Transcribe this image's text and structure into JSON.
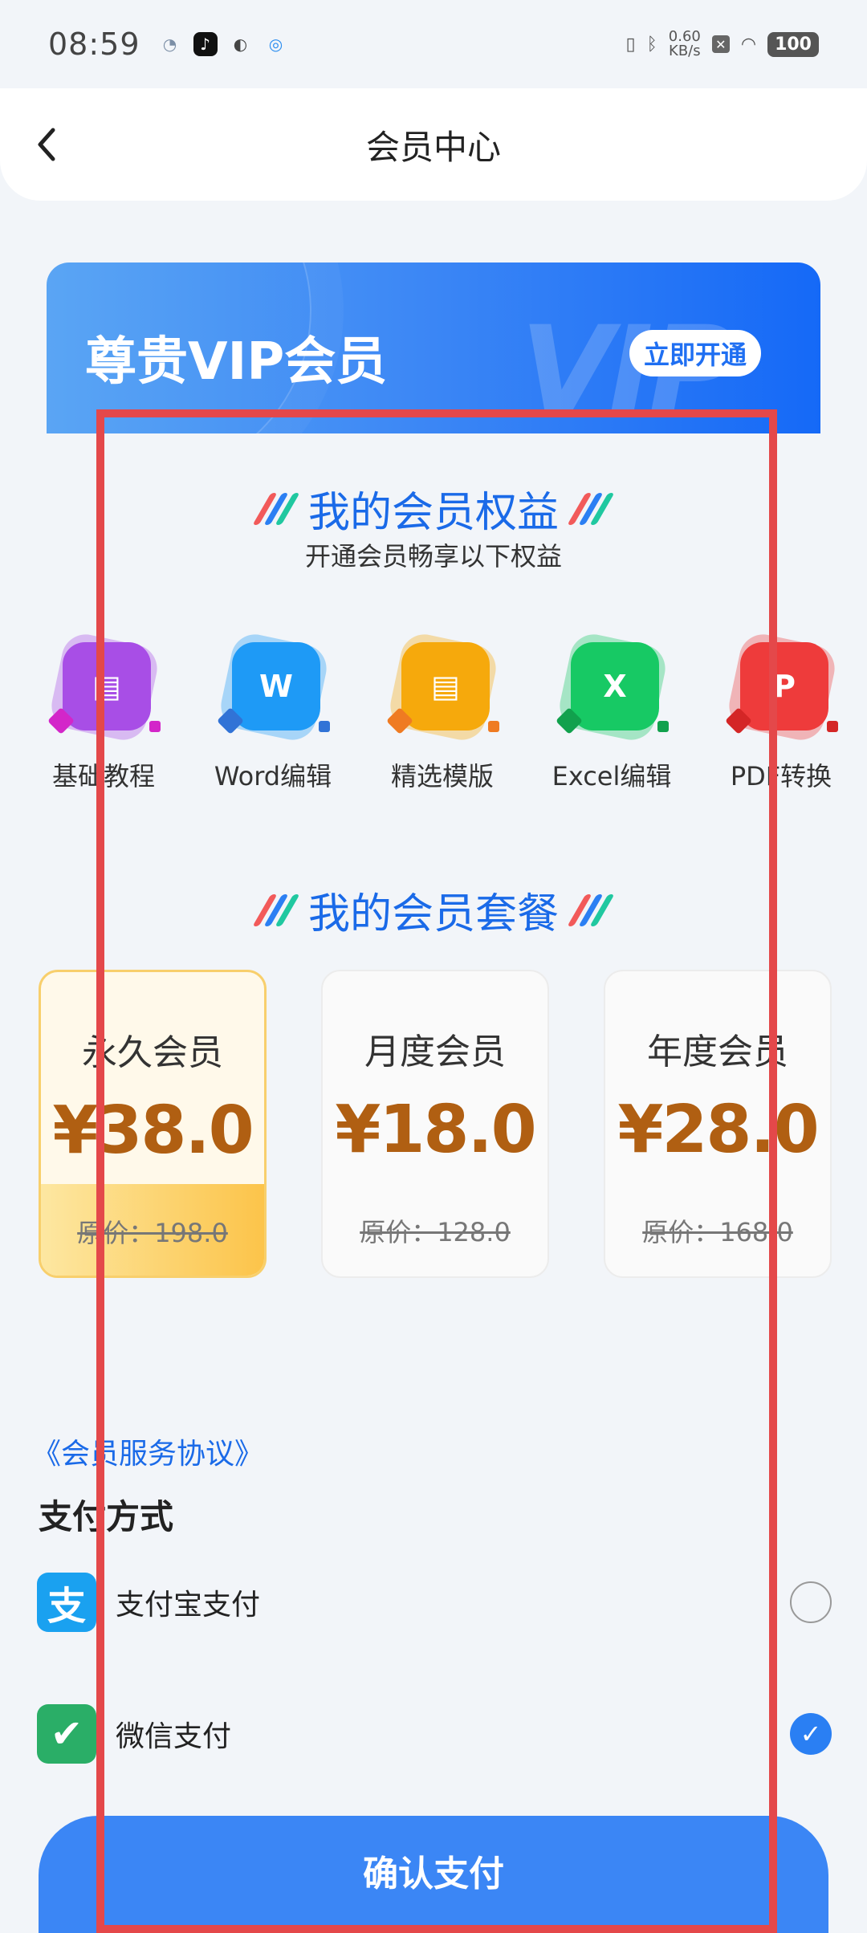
{
  "status_bar": {
    "time": "08:59",
    "net_speed_value": "0.60",
    "net_speed_unit": "KB/s",
    "battery": "100"
  },
  "header": {
    "title": "会员中心"
  },
  "banner": {
    "title": "尊贵VIP会员",
    "bg_text": "VIP",
    "open_button": "立即开通"
  },
  "benefits_section": {
    "title": "我的会员权益",
    "subtitle": "开通会员畅享以下权益",
    "items": [
      {
        "label": "基础教程",
        "icon": "tutorial-icon",
        "color": "#a84ee6",
        "glyph": "▤"
      },
      {
        "label": "Word编辑",
        "icon": "word-icon",
        "color": "#1e9af6",
        "glyph": "W"
      },
      {
        "label": "精选模版",
        "icon": "template-icon",
        "color": "#f6a90c",
        "glyph": "▤"
      },
      {
        "label": "Excel编辑",
        "icon": "excel-icon",
        "color": "#17c964",
        "glyph": "X"
      },
      {
        "label": "PDF转换",
        "icon": "pdf-icon",
        "color": "#ee3b3b",
        "glyph": "P"
      }
    ]
  },
  "plans_section": {
    "title": "我的会员套餐",
    "plans": [
      {
        "name": "永久会员",
        "price": "¥38.0",
        "original": "原价：198.0",
        "selected": true
      },
      {
        "name": "月度会员",
        "price": "¥18.0",
        "original": "原价：128.0",
        "selected": false
      },
      {
        "name": "年度会员",
        "price": "¥28.0",
        "original": "原价：168.0",
        "selected": false
      }
    ]
  },
  "agreement_link": "《会员服务协议》",
  "payment": {
    "title": "支付方式",
    "methods": [
      {
        "label": "支付宝支付",
        "icon": "alipay-icon",
        "color": "#1aa1f0",
        "selected": false
      },
      {
        "label": "微信支付",
        "icon": "wechat-icon",
        "color": "#2aae67",
        "selected": true
      }
    ]
  },
  "confirm_button": "确认支付",
  "colors": {
    "accent": "#3b86f5",
    "price": "#b05f12",
    "highlight_box": "#e4484a"
  }
}
